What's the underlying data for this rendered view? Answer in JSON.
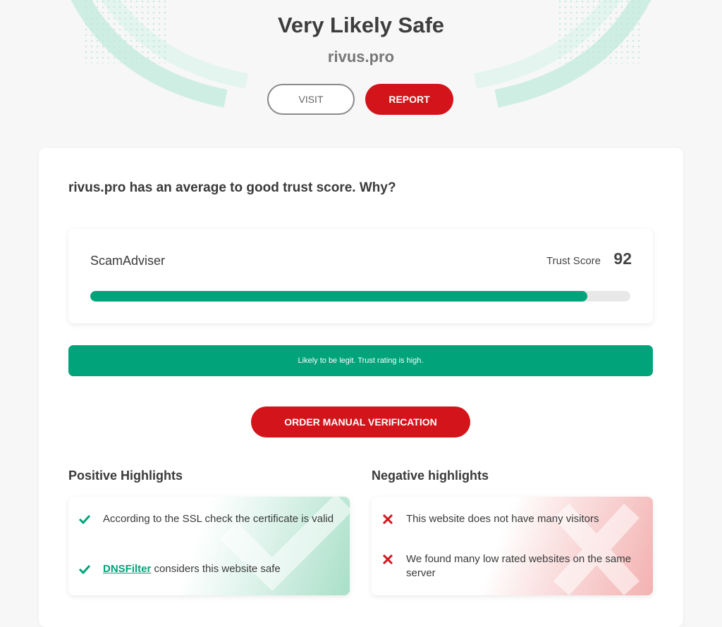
{
  "hero": {
    "title": "Very Likely Safe",
    "domain": "rivus.pro",
    "visit_label": "VISIT",
    "report_label": "REPORT"
  },
  "summary": {
    "heading": "rivus.pro has an average to good trust score. Why?"
  },
  "score": {
    "brand": "ScamAdviser",
    "label": "Trust Score",
    "value": "92",
    "fill_fraction": 0.92
  },
  "banner": {
    "text": "Likely to be legit. Trust rating is high."
  },
  "actions": {
    "order_label": "ORDER MANUAL VERIFICATION"
  },
  "positive": {
    "title": "Positive Highlights",
    "items": [
      {
        "text": "According to the SSL check the certificate is valid"
      },
      {
        "link": "DNSFilter",
        "text": " considers this website safe"
      }
    ]
  },
  "negative": {
    "title": "Negative highlights",
    "items": [
      {
        "text": "This website does not have many visitors"
      },
      {
        "text": "We found many low rated websites on the same server"
      }
    ]
  },
  "colors": {
    "accent_green": "#00a37a",
    "accent_red": "#d3141a",
    "check_icon": "check-icon",
    "cross_icon": "cross-icon"
  }
}
